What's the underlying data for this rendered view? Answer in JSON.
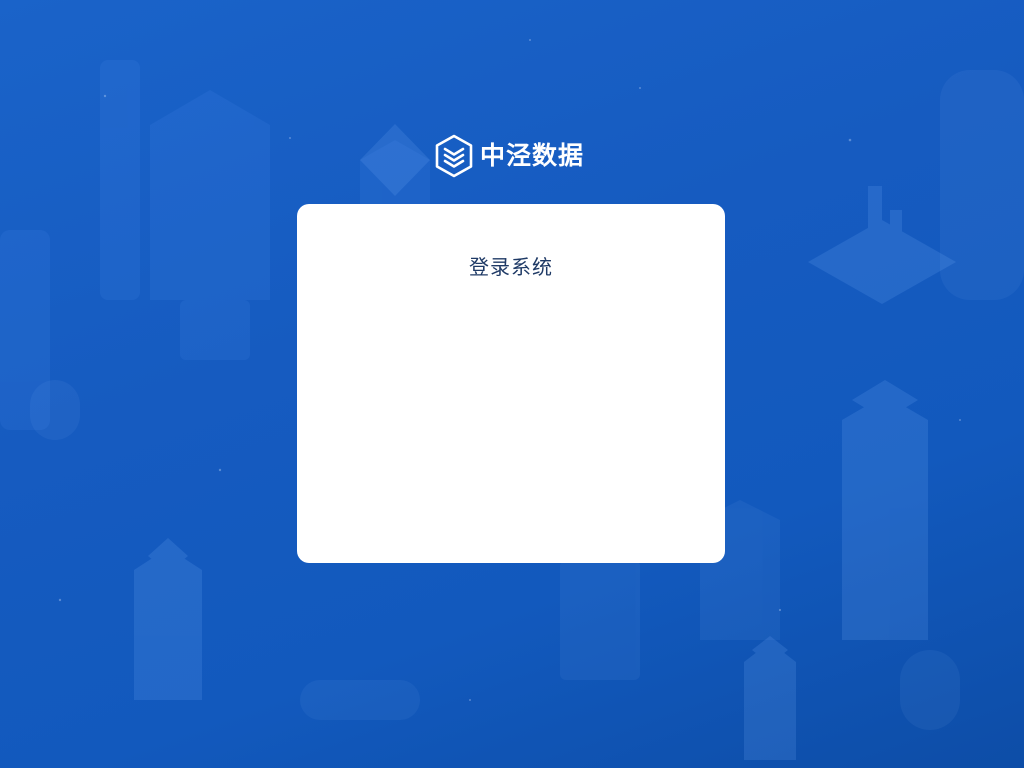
{
  "brand": {
    "logo_icon": "stacked-chevrons-hexagon-icon",
    "name": "中泾数据"
  },
  "login": {
    "title": "登录系统"
  },
  "colors": {
    "background": "#1a5fc4",
    "card": "#ffffff",
    "title_text": "#1f3a66"
  }
}
